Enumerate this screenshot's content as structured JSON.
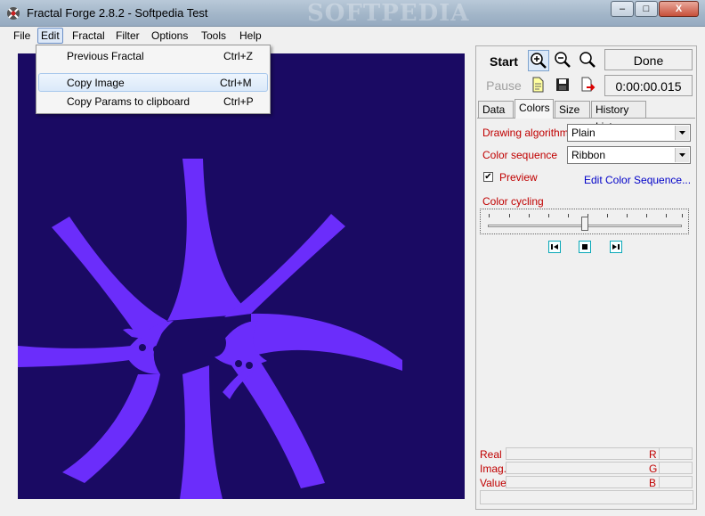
{
  "window": {
    "title": "Fractal Forge 2.8.2 - Softpedia Test",
    "watermark": "SOFTPEDIA",
    "controls": {
      "minimize": "‒",
      "maximize": "□",
      "close": "X"
    }
  },
  "menubar": {
    "items": [
      "File",
      "Edit",
      "Fractal",
      "Filter",
      "Options",
      "Tools",
      "Help"
    ],
    "active": "Edit"
  },
  "edit_menu": {
    "items": [
      {
        "label": "Previous Fractal",
        "shortcut": "Ctrl+Z"
      },
      {
        "label": "Copy Image",
        "shortcut": "Ctrl+M"
      },
      {
        "label": "Copy Params to clipboard",
        "shortcut": "Ctrl+P"
      }
    ]
  },
  "toolbar": {
    "start_label": "Start",
    "pause_label": "Pause",
    "status": "Done",
    "elapsed": "0:00:00.015"
  },
  "tabs": [
    "Data",
    "Colors",
    "Size",
    "History List"
  ],
  "active_tab": "Colors",
  "colors_tab": {
    "drawing_algorithm_label": "Drawing algorithm",
    "drawing_algorithm_value": "Plain",
    "color_sequence_label": "Color sequence",
    "color_sequence_value": "Ribbon",
    "preview_label": "Preview",
    "preview_checked": "✔",
    "edit_link": "Edit Color Sequence...",
    "color_cycling_label": "Color cycling",
    "color_cycling_level": 0.5
  },
  "info": {
    "rows": [
      {
        "label": "Real",
        "letter": "R"
      },
      {
        "label": "Imag.",
        "letter": "G"
      },
      {
        "label": "Value",
        "letter": "B"
      }
    ]
  },
  "colors": {
    "fractal_background": "#1a0a63",
    "fractal_fill": "#6b2dfb",
    "label_red": "#c00000",
    "link_blue": "#0000c8"
  }
}
